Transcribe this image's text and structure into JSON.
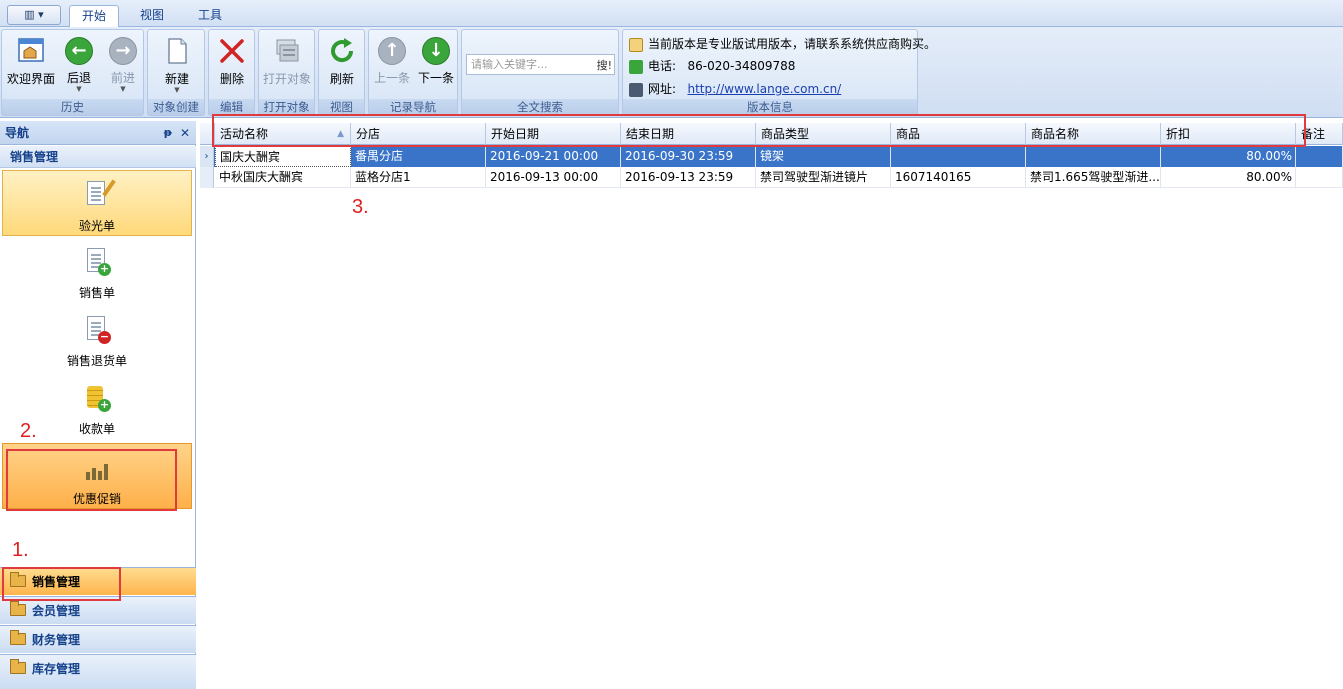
{
  "tabs": [
    "开始",
    "视图",
    "工具"
  ],
  "ribbon": {
    "groups": {
      "history": "历史",
      "create": "对象创建",
      "edit": "编辑",
      "open": "打开对象",
      "view": "视图",
      "nav": "记录导航",
      "search": "全文搜索",
      "version": "版本信息"
    },
    "buttons": {
      "welcome": "欢迎界面",
      "back": "后退",
      "forward": "前进",
      "new": "新建",
      "delete": "删除",
      "open": "打开对象",
      "refresh": "刷新",
      "prev": "上一条",
      "next": "下一条"
    },
    "search": {
      "placeholder": "请输入关键字...",
      "button": "搜!"
    },
    "info": {
      "notice": "当前版本是专业版试用版本，请联系系统供应商购买。",
      "phone_label": "电话:",
      "phone": "86-020-34809788",
      "site_label": "网址:",
      "site": "http://www.lange.com.cn/"
    }
  },
  "nav": {
    "title": "导航",
    "pin": "ᵽ",
    "close": "✕",
    "group_title": "销售管理",
    "items": [
      "验光单",
      "销售单",
      "销售退货单",
      "收款单",
      "优惠促销"
    ],
    "bottom_groups": [
      "销售管理",
      "会员管理",
      "财务管理",
      "库存管理"
    ]
  },
  "grid": {
    "columns": [
      "活动名称",
      "分店",
      "开始日期",
      "结束日期",
      "商品类型",
      "商品",
      "商品名称",
      "折扣",
      "备注"
    ],
    "rows": [
      [
        "国庆大酬宾",
        "番禺分店",
        "2016-09-21 00:00",
        "2016-09-30 23:59",
        "镜架",
        "",
        "",
        "80.00%",
        ""
      ],
      [
        "中秋国庆大酬宾",
        "蓝格分店1",
        "2016-09-13 00:00",
        "2016-09-13 23:59",
        "禁司驾驶型渐进镜片",
        "1607140165",
        "禁司1.665驾驶型渐进...",
        "80.00%",
        ""
      ]
    ]
  },
  "annotations": [
    "1.",
    "2.",
    "3."
  ],
  "colors": {
    "selection": "#3a74c8",
    "annotation": "#e0393e",
    "hover": "#ffb04a"
  }
}
